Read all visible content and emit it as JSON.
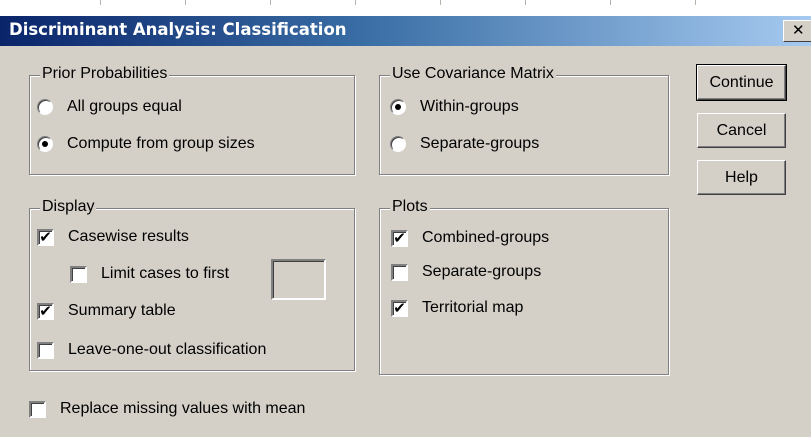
{
  "window": {
    "title": "Discriminant Analysis: Classification",
    "close_glyph": "✕",
    "close_icon": "close-icon",
    "colors": {
      "title_gradient_start": "#0a246a",
      "title_gradient_end": "#a6caf0",
      "dialog_face": "#d4d0c8"
    }
  },
  "prior_probabilities": {
    "legend": "Prior Probabilities",
    "options": [
      {
        "label": "All groups equal",
        "selected": false
      },
      {
        "label": "Compute from group sizes",
        "selected": true
      }
    ]
  },
  "covariance_matrix": {
    "legend": "Use Covariance Matrix",
    "options": [
      {
        "label": "Within-groups",
        "selected": true
      },
      {
        "label": "Separate-groups",
        "selected": false
      }
    ]
  },
  "display": {
    "legend": "Display",
    "casewise_results": {
      "label": "Casewise results",
      "checked": true
    },
    "limit_cases": {
      "label": "Limit cases to first",
      "checked": false,
      "value": ""
    },
    "summary_table": {
      "label": "Summary table",
      "checked": true
    },
    "leave_one_out": {
      "label": "Leave-one-out classification",
      "checked": false
    }
  },
  "plots": {
    "legend": "Plots",
    "combined_groups": {
      "label": "Combined-groups",
      "checked": true
    },
    "separate_groups": {
      "label": "Separate-groups",
      "checked": false
    },
    "territorial_map": {
      "label": "Territorial map",
      "checked": true
    }
  },
  "replace_missing": {
    "label": "Replace missing values with mean",
    "checked": false
  },
  "buttons": {
    "continue": "Continue",
    "cancel": "Cancel",
    "help": "Help"
  }
}
